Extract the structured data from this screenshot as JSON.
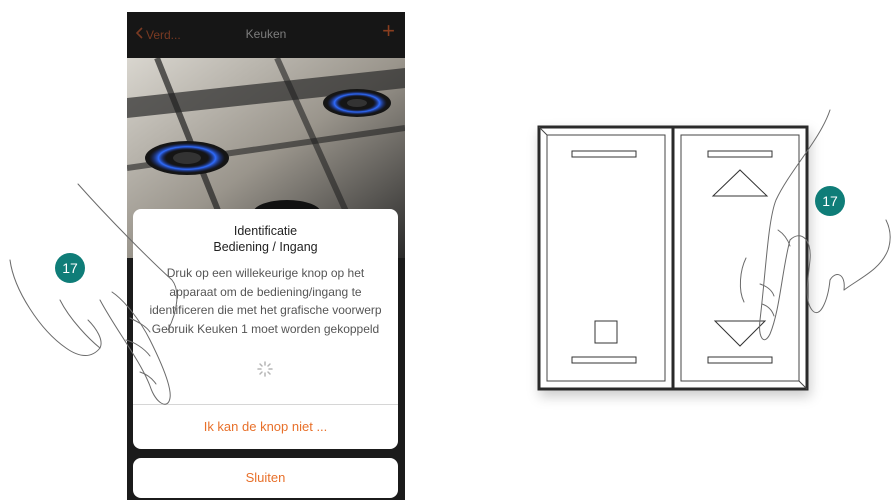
{
  "navbar": {
    "back_label": "Verd...",
    "title": "Keuken",
    "add_icon": "plus-icon"
  },
  "dialog": {
    "title_line1": "Identificatie",
    "title_line2": "Bediening / Ingang",
    "message_lines": [
      "Druk op een willekeurige knop op het",
      "apparaat om de bediening/ingang te",
      "identificeren die met het grafische voorwerp",
      "Gebruik Keuken 1 moet worden gekoppeld"
    ],
    "action_label": "Ik kan de knop niet ..."
  },
  "close_label": "Sluiten",
  "step_badges": [
    "17",
    "17"
  ],
  "colors": {
    "accent": "#e8702a",
    "badge": "#0f7d78",
    "navbar": "#161616"
  }
}
